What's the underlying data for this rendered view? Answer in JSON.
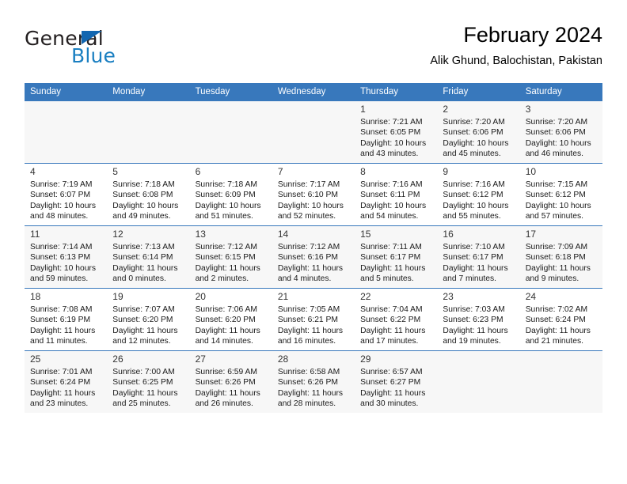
{
  "brand": {
    "name_dark": "General",
    "name_blue": "Blue",
    "triangle_color": "#1266b0",
    "blue_color": "#1a7fc1"
  },
  "header": {
    "title": "February 2024",
    "subtitle": "Alik Ghund, Balochistan, Pakistan"
  },
  "theme": {
    "header_bg": "#3878bc",
    "header_text": "#ffffff",
    "row_shade": "#f7f7f7",
    "grid_line": "#3878bc"
  },
  "calendar": {
    "weekday_headers": [
      "Sunday",
      "Monday",
      "Tuesday",
      "Wednesday",
      "Thursday",
      "Friday",
      "Saturday"
    ],
    "weeks": [
      [
        {
          "day": "",
          "sunrise": "",
          "sunset": "",
          "daylight_line1": "",
          "daylight_line2": ""
        },
        {
          "day": "",
          "sunrise": "",
          "sunset": "",
          "daylight_line1": "",
          "daylight_line2": ""
        },
        {
          "day": "",
          "sunrise": "",
          "sunset": "",
          "daylight_line1": "",
          "daylight_line2": ""
        },
        {
          "day": "",
          "sunrise": "",
          "sunset": "",
          "daylight_line1": "",
          "daylight_line2": ""
        },
        {
          "day": "1",
          "sunrise": "Sunrise: 7:21 AM",
          "sunset": "Sunset: 6:05 PM",
          "daylight_line1": "Daylight: 10 hours",
          "daylight_line2": "and 43 minutes."
        },
        {
          "day": "2",
          "sunrise": "Sunrise: 7:20 AM",
          "sunset": "Sunset: 6:06 PM",
          "daylight_line1": "Daylight: 10 hours",
          "daylight_line2": "and 45 minutes."
        },
        {
          "day": "3",
          "sunrise": "Sunrise: 7:20 AM",
          "sunset": "Sunset: 6:06 PM",
          "daylight_line1": "Daylight: 10 hours",
          "daylight_line2": "and 46 minutes."
        }
      ],
      [
        {
          "day": "4",
          "sunrise": "Sunrise: 7:19 AM",
          "sunset": "Sunset: 6:07 PM",
          "daylight_line1": "Daylight: 10 hours",
          "daylight_line2": "and 48 minutes."
        },
        {
          "day": "5",
          "sunrise": "Sunrise: 7:18 AM",
          "sunset": "Sunset: 6:08 PM",
          "daylight_line1": "Daylight: 10 hours",
          "daylight_line2": "and 49 minutes."
        },
        {
          "day": "6",
          "sunrise": "Sunrise: 7:18 AM",
          "sunset": "Sunset: 6:09 PM",
          "daylight_line1": "Daylight: 10 hours",
          "daylight_line2": "and 51 minutes."
        },
        {
          "day": "7",
          "sunrise": "Sunrise: 7:17 AM",
          "sunset": "Sunset: 6:10 PM",
          "daylight_line1": "Daylight: 10 hours",
          "daylight_line2": "and 52 minutes."
        },
        {
          "day": "8",
          "sunrise": "Sunrise: 7:16 AM",
          "sunset": "Sunset: 6:11 PM",
          "daylight_line1": "Daylight: 10 hours",
          "daylight_line2": "and 54 minutes."
        },
        {
          "day": "9",
          "sunrise": "Sunrise: 7:16 AM",
          "sunset": "Sunset: 6:12 PM",
          "daylight_line1": "Daylight: 10 hours",
          "daylight_line2": "and 55 minutes."
        },
        {
          "day": "10",
          "sunrise": "Sunrise: 7:15 AM",
          "sunset": "Sunset: 6:12 PM",
          "daylight_line1": "Daylight: 10 hours",
          "daylight_line2": "and 57 minutes."
        }
      ],
      [
        {
          "day": "11",
          "sunrise": "Sunrise: 7:14 AM",
          "sunset": "Sunset: 6:13 PM",
          "daylight_line1": "Daylight: 10 hours",
          "daylight_line2": "and 59 minutes."
        },
        {
          "day": "12",
          "sunrise": "Sunrise: 7:13 AM",
          "sunset": "Sunset: 6:14 PM",
          "daylight_line1": "Daylight: 11 hours",
          "daylight_line2": "and 0 minutes."
        },
        {
          "day": "13",
          "sunrise": "Sunrise: 7:12 AM",
          "sunset": "Sunset: 6:15 PM",
          "daylight_line1": "Daylight: 11 hours",
          "daylight_line2": "and 2 minutes."
        },
        {
          "day": "14",
          "sunrise": "Sunrise: 7:12 AM",
          "sunset": "Sunset: 6:16 PM",
          "daylight_line1": "Daylight: 11 hours",
          "daylight_line2": "and 4 minutes."
        },
        {
          "day": "15",
          "sunrise": "Sunrise: 7:11 AM",
          "sunset": "Sunset: 6:17 PM",
          "daylight_line1": "Daylight: 11 hours",
          "daylight_line2": "and 5 minutes."
        },
        {
          "day": "16",
          "sunrise": "Sunrise: 7:10 AM",
          "sunset": "Sunset: 6:17 PM",
          "daylight_line1": "Daylight: 11 hours",
          "daylight_line2": "and 7 minutes."
        },
        {
          "day": "17",
          "sunrise": "Sunrise: 7:09 AM",
          "sunset": "Sunset: 6:18 PM",
          "daylight_line1": "Daylight: 11 hours",
          "daylight_line2": "and 9 minutes."
        }
      ],
      [
        {
          "day": "18",
          "sunrise": "Sunrise: 7:08 AM",
          "sunset": "Sunset: 6:19 PM",
          "daylight_line1": "Daylight: 11 hours",
          "daylight_line2": "and 11 minutes."
        },
        {
          "day": "19",
          "sunrise": "Sunrise: 7:07 AM",
          "sunset": "Sunset: 6:20 PM",
          "daylight_line1": "Daylight: 11 hours",
          "daylight_line2": "and 12 minutes."
        },
        {
          "day": "20",
          "sunrise": "Sunrise: 7:06 AM",
          "sunset": "Sunset: 6:20 PM",
          "daylight_line1": "Daylight: 11 hours",
          "daylight_line2": "and 14 minutes."
        },
        {
          "day": "21",
          "sunrise": "Sunrise: 7:05 AM",
          "sunset": "Sunset: 6:21 PM",
          "daylight_line1": "Daylight: 11 hours",
          "daylight_line2": "and 16 minutes."
        },
        {
          "day": "22",
          "sunrise": "Sunrise: 7:04 AM",
          "sunset": "Sunset: 6:22 PM",
          "daylight_line1": "Daylight: 11 hours",
          "daylight_line2": "and 17 minutes."
        },
        {
          "day": "23",
          "sunrise": "Sunrise: 7:03 AM",
          "sunset": "Sunset: 6:23 PM",
          "daylight_line1": "Daylight: 11 hours",
          "daylight_line2": "and 19 minutes."
        },
        {
          "day": "24",
          "sunrise": "Sunrise: 7:02 AM",
          "sunset": "Sunset: 6:24 PM",
          "daylight_line1": "Daylight: 11 hours",
          "daylight_line2": "and 21 minutes."
        }
      ],
      [
        {
          "day": "25",
          "sunrise": "Sunrise: 7:01 AM",
          "sunset": "Sunset: 6:24 PM",
          "daylight_line1": "Daylight: 11 hours",
          "daylight_line2": "and 23 minutes."
        },
        {
          "day": "26",
          "sunrise": "Sunrise: 7:00 AM",
          "sunset": "Sunset: 6:25 PM",
          "daylight_line1": "Daylight: 11 hours",
          "daylight_line2": "and 25 minutes."
        },
        {
          "day": "27",
          "sunrise": "Sunrise: 6:59 AM",
          "sunset": "Sunset: 6:26 PM",
          "daylight_line1": "Daylight: 11 hours",
          "daylight_line2": "and 26 minutes."
        },
        {
          "day": "28",
          "sunrise": "Sunrise: 6:58 AM",
          "sunset": "Sunset: 6:26 PM",
          "daylight_line1": "Daylight: 11 hours",
          "daylight_line2": "and 28 minutes."
        },
        {
          "day": "29",
          "sunrise": "Sunrise: 6:57 AM",
          "sunset": "Sunset: 6:27 PM",
          "daylight_line1": "Daylight: 11 hours",
          "daylight_line2": "and 30 minutes."
        },
        {
          "day": "",
          "sunrise": "",
          "sunset": "",
          "daylight_line1": "",
          "daylight_line2": ""
        },
        {
          "day": "",
          "sunrise": "",
          "sunset": "",
          "daylight_line1": "",
          "daylight_line2": ""
        }
      ]
    ]
  }
}
